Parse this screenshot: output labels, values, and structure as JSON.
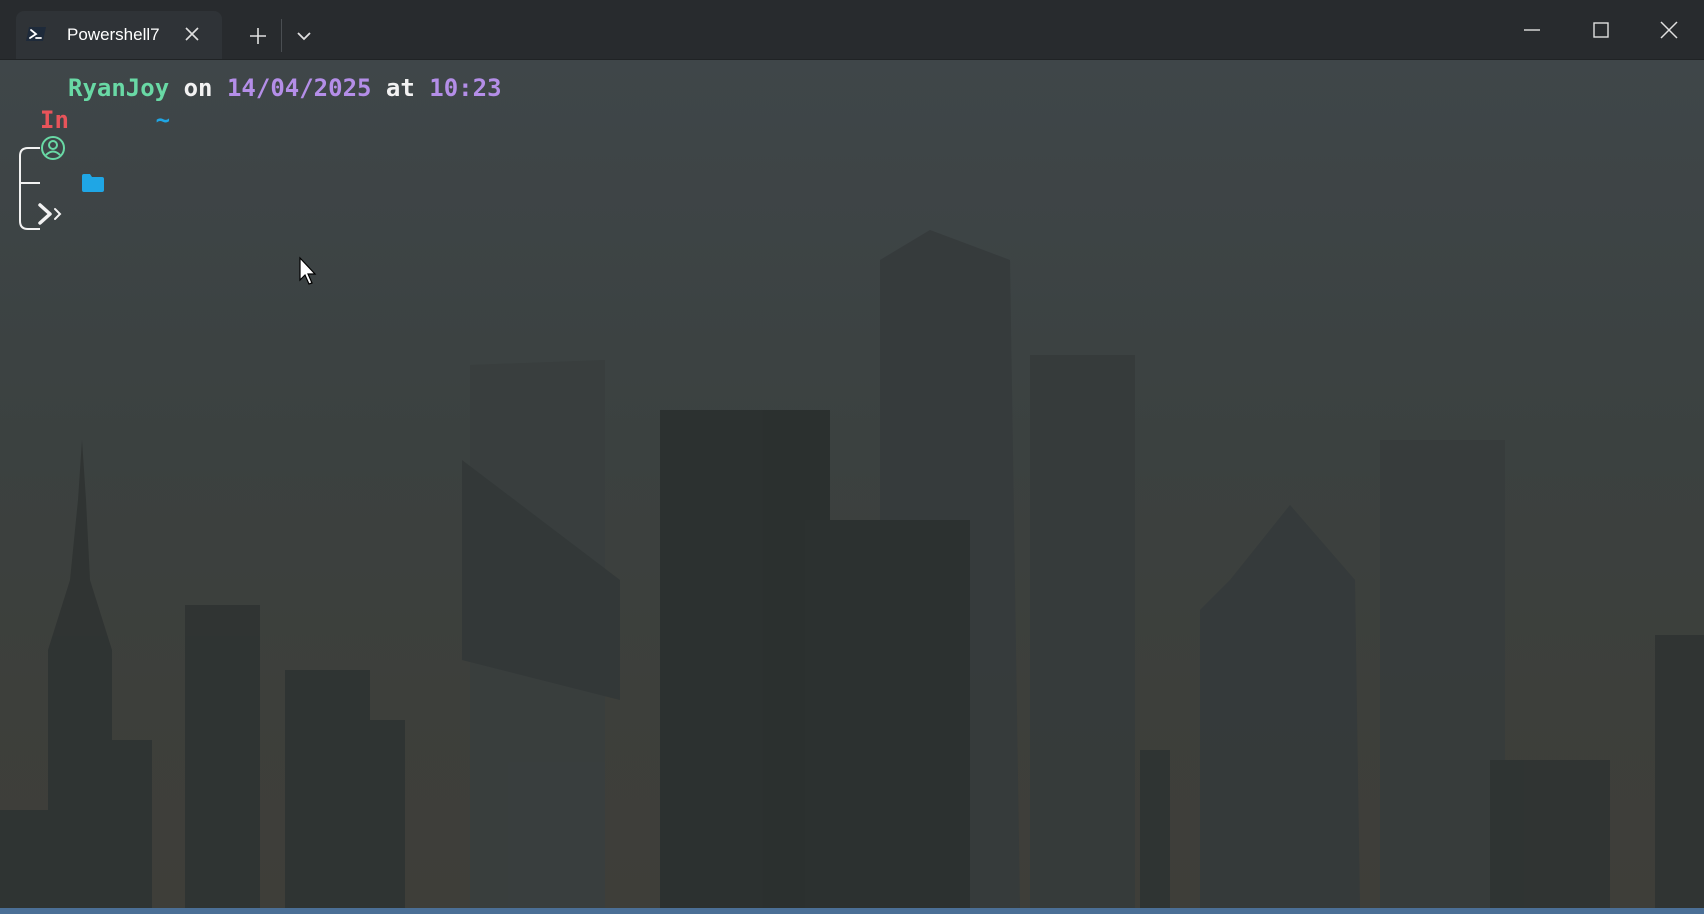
{
  "window": {
    "tab_title": "Powershell7",
    "tab_icon": "powershell-icon",
    "new_tab_icon": "plus-icon",
    "dropdown_icon": "chevron-down-icon",
    "controls": [
      "minimize-icon",
      "maximize-icon",
      "close-icon"
    ]
  },
  "prompt": {
    "user": "RyanJoy",
    "on": "on",
    "date": "14/04/2025",
    "at": "at",
    "time": "10:23",
    "in": "In",
    "dir": "~",
    "user_icon": "user-circle-icon",
    "folder_icon": "folder-icon",
    "prompt_icon": "double-chevron-icon"
  },
  "colors": {
    "titlebar": "#282b2e",
    "tab": "#2f3337",
    "user": "#69d9a5",
    "date": "#b48ee8",
    "in": "#e8545a",
    "dir": "#1fa6e5",
    "text": "#f2f2f2"
  }
}
